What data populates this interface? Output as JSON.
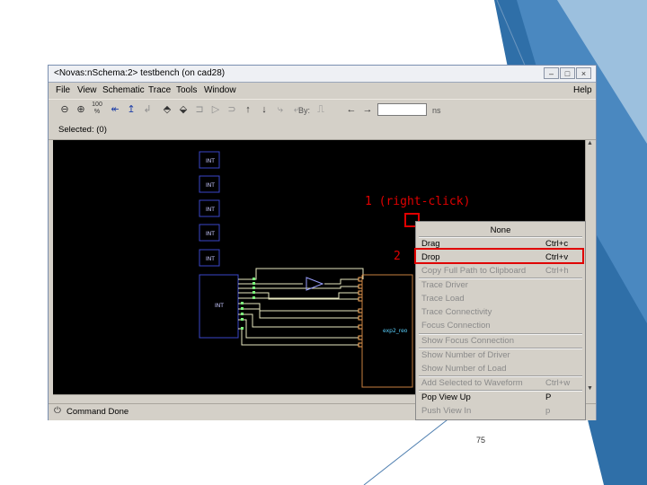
{
  "window": {
    "title": "<Novas:nSchema:2> testbench (on cad28)",
    "buttons": [
      "–",
      "□",
      "×"
    ]
  },
  "menubar": {
    "items": [
      "File",
      "View",
      "Schematic",
      "Trace",
      "Tools",
      "Window"
    ],
    "help": "Help"
  },
  "toolbar": {
    "zoom_label": "100\n%",
    "by_label": "By:",
    "time_unit": "ns",
    "time_value": ""
  },
  "selected_label": "Selected: (0)",
  "schematic": {
    "int_blocks": [
      "INT",
      "INT",
      "INT",
      "INT",
      "INT"
    ],
    "main_block": "INT",
    "signal_label": "exp2_reo"
  },
  "status_text": "Command Done",
  "annotations": {
    "step1": "1 (right-click)",
    "step2": "2"
  },
  "context_menu": {
    "header": "None",
    "items": [
      {
        "label": "Drag",
        "shortcut": "Ctrl+c",
        "enabled": true
      },
      {
        "label": "Drop",
        "shortcut": "Ctrl+v",
        "enabled": true
      },
      {
        "label": "Copy Full Path to Clipboard",
        "shortcut": "Ctrl+h",
        "enabled": false
      },
      {
        "label": "Trace Driver",
        "shortcut": "",
        "enabled": false
      },
      {
        "label": "Trace Load",
        "shortcut": "",
        "enabled": false
      },
      {
        "label": "Trace Connectivity",
        "shortcut": "",
        "enabled": false
      },
      {
        "label": "Focus Connection",
        "shortcut": "",
        "enabled": false
      },
      {
        "label": "Show Focus Connection",
        "shortcut": "",
        "enabled": false
      },
      {
        "label": "Show Number of Driver",
        "shortcut": "",
        "enabled": false
      },
      {
        "label": "Show Number of Load",
        "shortcut": "",
        "enabled": false
      },
      {
        "label": "Add Selected to Waveform",
        "shortcut": "Ctrl+w",
        "enabled": false
      },
      {
        "label": "Pop View Up",
        "shortcut": "P",
        "enabled": true
      },
      {
        "label": "Push View In",
        "shortcut": "p",
        "enabled": false
      }
    ]
  },
  "page_number": "75",
  "colors": {
    "highlight_box": "#e00000",
    "canvas": "#000000",
    "slide_blue": "#2f6fa8"
  }
}
